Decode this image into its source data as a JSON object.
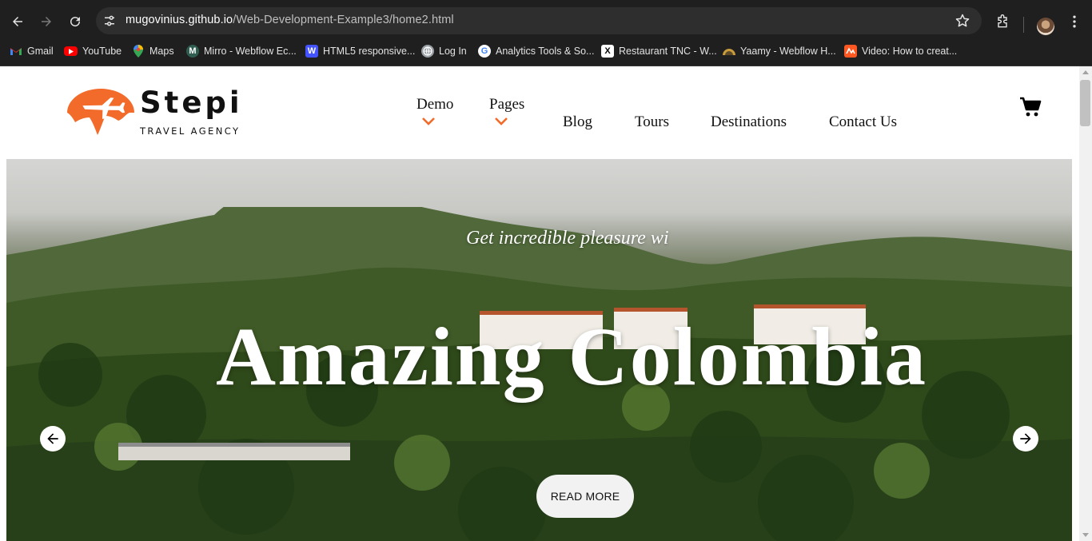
{
  "browser": {
    "url_host": "mugovinius.github.io",
    "url_path": "/Web-Development-Example3/home2.html",
    "bookmarks": [
      {
        "label": "Gmail",
        "icon": "gmail-icon",
        "color": "#ea4335"
      },
      {
        "label": "YouTube",
        "icon": "youtube-icon",
        "color": "#ff0000"
      },
      {
        "label": "Maps",
        "icon": "maps-icon",
        "color": "#34a853"
      },
      {
        "label": "Mirro - Webflow Ec...",
        "icon": "mirro-icon",
        "color": "#2f5d50"
      },
      {
        "label": "HTML5 responsive...",
        "icon": "w-icon",
        "color": "#4353ff"
      },
      {
        "label": "Log In",
        "icon": "globe-icon",
        "color": "#9aa0a6"
      },
      {
        "label": "Analytics Tools & So...",
        "icon": "google-icon",
        "color": "#4285f4"
      },
      {
        "label": "Restaurant TNC - W...",
        "icon": "x-icon",
        "color": "#000000"
      },
      {
        "label": "Yaamy - Webflow H...",
        "icon": "yaamy-icon",
        "color": "#c89b3c"
      },
      {
        "label": "Video: How to creat...",
        "icon": "video-icon",
        "color": "#ff5722"
      }
    ]
  },
  "site": {
    "brand": "Stepi",
    "tagline": "TRAVEL AGENCY",
    "accent": "#f26b2a",
    "nav": {
      "demo": "Demo",
      "pages": "Pages",
      "blog": "Blog",
      "tours": "Tours",
      "destinations": "Destinations",
      "contact": "Contact Us"
    },
    "cart_icon": "shopping-cart-icon"
  },
  "hero": {
    "subtitle": "Get incredible pleasure wi",
    "title": "Amazing Colombia",
    "button": "READ MORE",
    "prev_icon": "arrow-left-icon",
    "next_icon": "arrow-right-icon"
  }
}
